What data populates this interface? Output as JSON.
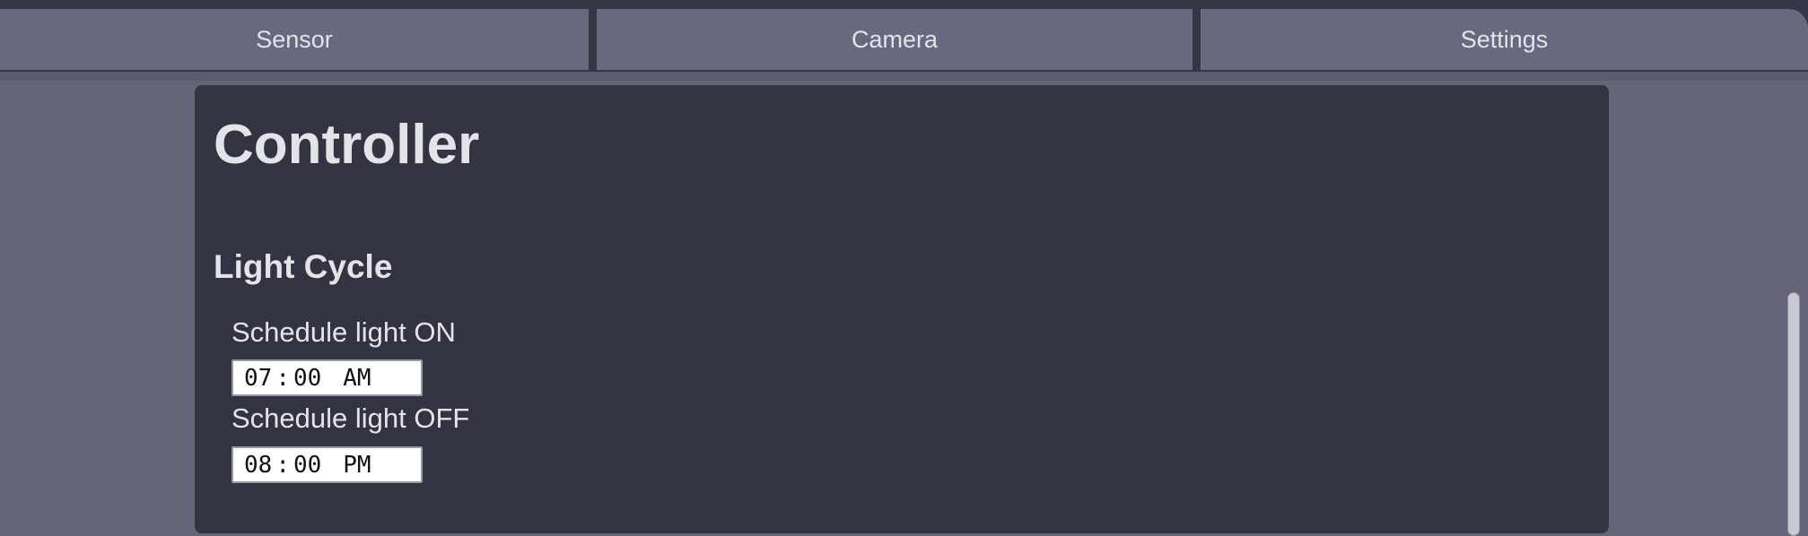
{
  "tabs": [
    {
      "label": "Sensor"
    },
    {
      "label": "Camera"
    },
    {
      "label": "Settings"
    }
  ],
  "page": {
    "title": "Controller"
  },
  "light_cycle": {
    "heading": "Light Cycle",
    "on": {
      "label": "Schedule light ON",
      "hour": "07",
      "minute": "00",
      "period": "AM"
    },
    "off": {
      "label": "Schedule light OFF",
      "hour": "08",
      "minute": "00",
      "period": "PM"
    },
    "separator": ":"
  },
  "colors": {
    "background": "#636478",
    "tab": "#676a7e",
    "card": "#333441",
    "text": "#e3e4ea"
  }
}
